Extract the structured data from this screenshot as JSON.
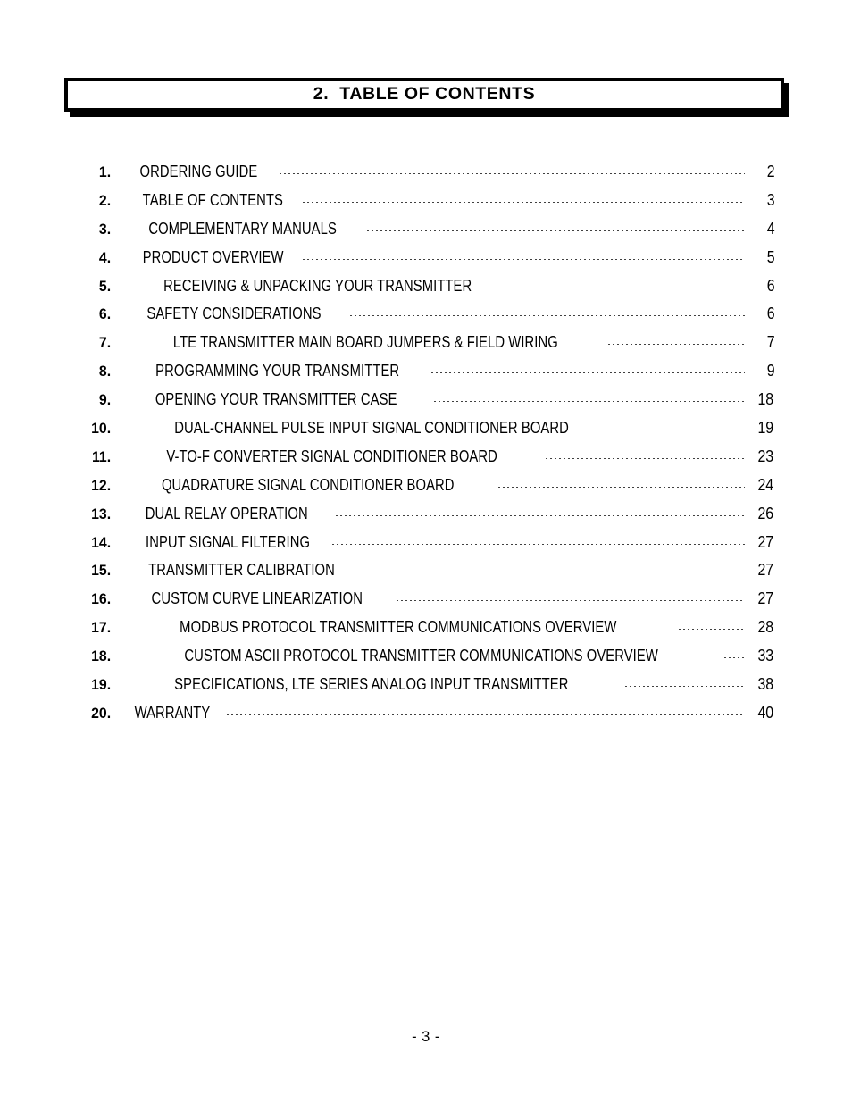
{
  "document": {
    "heading": "2.  TABLE OF CONTENTS",
    "footer": "- 3 -"
  },
  "toc": {
    "entries": [
      {
        "number": "1.",
        "title": "ORDERING GUIDE",
        "page": "2",
        "gap": true
      },
      {
        "number": "2.",
        "title": "TABLE OF CONTENTS",
        "page": "3",
        "gap": false
      },
      {
        "number": "3.",
        "title": "COMPLEMENTARY MANUALS",
        "page": "4",
        "gap": true
      },
      {
        "number": "4.",
        "title": "PRODUCT OVERVIEW",
        "page": "5",
        "gap": false
      },
      {
        "number": "5.",
        "title": "RECEIVING & UNPACKING YOUR TRANSMITTER",
        "page": "6",
        "gap": true
      },
      {
        "number": "6.",
        "title": "SAFETY CONSIDERATIONS",
        "page": "6",
        "gap": true
      },
      {
        "number": "7.",
        "title": "LTE TRANSMITTER MAIN BOARD JUMPERS & FIELD WIRING",
        "page": "7",
        "gap": false
      },
      {
        "number": "8.",
        "title": "PROGRAMMING YOUR TRANSMITTER",
        "page": "9",
        "gap": false
      },
      {
        "number": "9.",
        "title": "OPENING YOUR TRANSMITTER CASE",
        "page": "18",
        "gap": true
      },
      {
        "number": "10.",
        "title": "DUAL-CHANNEL PULSE INPUT SIGNAL CONDITIONER BOARD",
        "page": "19",
        "gap": false
      },
      {
        "number": "11.",
        "title": "V-TO-F CONVERTER SIGNAL CONDITIONER BOARD",
        "page": "23",
        "gap": true
      },
      {
        "number": "12.",
        "title": "QUADRATURE SIGNAL CONDITIONER BOARD",
        "page": "24",
        "gap": true
      },
      {
        "number": "13.",
        "title": "DUAL RELAY OPERATION",
        "page": "26",
        "gap": true
      },
      {
        "number": "14.",
        "title": "INPUT SIGNAL FILTERING",
        "page": "27",
        "gap": false
      },
      {
        "number": "15.",
        "title": "TRANSMITTER CALIBRATION",
        "page": "27",
        "gap": true
      },
      {
        "number": "16.",
        "title": "CUSTOM CURVE LINEARIZATION",
        "page": "27",
        "gap": true
      },
      {
        "number": "17.",
        "title": "MODBUS PROTOCOL TRANSMITTER COMMUNICATIONS OVERVIEW",
        "page": "28",
        "gap": true
      },
      {
        "number": "18.",
        "title": "CUSTOM ASCII PROTOCOL TRANSMITTER COMMUNICATIONS OVERVIEW",
        "page": "33",
        "gap": true
      },
      {
        "number": "19.",
        "title": "SPECIFICATIONS, LTE SERIES ANALOG INPUT TRANSMITTER",
        "page": "38",
        "gap": true
      },
      {
        "number": "20.",
        "title": "WARRANTY",
        "page": "40",
        "gap": true
      }
    ]
  }
}
